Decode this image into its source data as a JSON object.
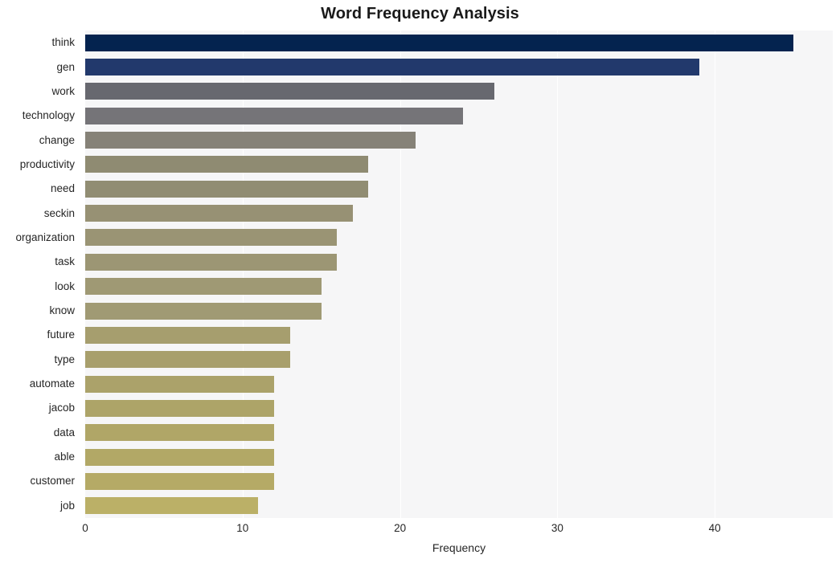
{
  "chart": {
    "title": "Word Frequency Analysis",
    "xlabel": "Frequency",
    "ylabel": ""
  },
  "axis": {
    "xticks": [
      "0",
      "10",
      "20",
      "30",
      "40"
    ]
  },
  "chart_data": {
    "type": "bar",
    "orientation": "horizontal",
    "title": "Word Frequency Analysis",
    "xlabel": "Frequency",
    "ylabel": "",
    "xlim": [
      0,
      47.5
    ],
    "grid": true,
    "legend": false,
    "xticks": [
      0,
      10,
      20,
      30,
      40
    ],
    "categories": [
      "think",
      "gen",
      "work",
      "technology",
      "change",
      "productivity",
      "need",
      "seckin",
      "organization",
      "task",
      "look",
      "know",
      "future",
      "type",
      "automate",
      "jacob",
      "data",
      "able",
      "customer",
      "job"
    ],
    "values": [
      45,
      39,
      26,
      24,
      21,
      18,
      18,
      17,
      16,
      16,
      15,
      15,
      13,
      13,
      12,
      12,
      12,
      12,
      12,
      11
    ],
    "bar_colors": [
      "#04234f",
      "#22396c",
      "#67686f",
      "#757478",
      "#868278",
      "#8f8b72",
      "#918d73",
      "#979174",
      "#9a9474",
      "#9c9674",
      "#9f9974",
      "#a09a74",
      "#a69e6e",
      "#a89f6c",
      "#aba26a",
      "#ada468",
      "#b0a667",
      "#b2a866",
      "#b5aa66",
      "#bbb067"
    ]
  },
  "colors": {
    "plot_background": "#f6f6f7",
    "figure_background": "#ffffff",
    "gridline": "#ffffff",
    "text": "#262626",
    "title": "#1a1a1a"
  }
}
